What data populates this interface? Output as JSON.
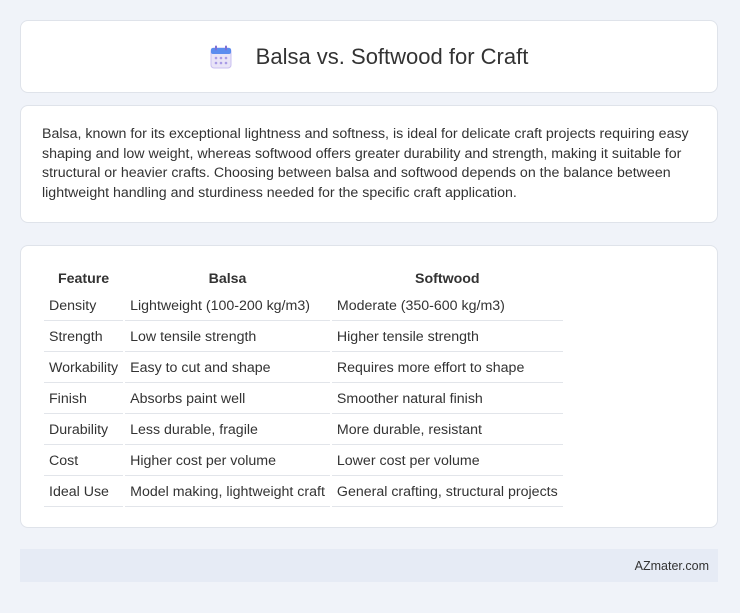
{
  "header": {
    "title": "Balsa vs. Softwood for Craft",
    "icon": "calendar-icon"
  },
  "description": "Balsa, known for its exceptional lightness and softness, is ideal for delicate craft projects requiring easy shaping and low weight, whereas softwood offers greater durability and strength, making it suitable for structural or heavier crafts. Choosing between balsa and softwood depends on the balance between lightweight handling and sturdiness needed for the specific craft application.",
  "table": {
    "headers": [
      "Feature",
      "Balsa",
      "Softwood"
    ],
    "rows": [
      [
        "Density",
        "Lightweight (100-200 kg/m3)",
        "Moderate (350-600 kg/m3)"
      ],
      [
        "Strength",
        "Low tensile strength",
        "Higher tensile strength"
      ],
      [
        "Workability",
        "Easy to cut and shape",
        "Requires more effort to shape"
      ],
      [
        "Finish",
        "Absorbs paint well",
        "Smoother natural finish"
      ],
      [
        "Durability",
        "Less durable, fragile",
        "More durable, resistant"
      ],
      [
        "Cost",
        "Higher cost per volume",
        "Lower cost per volume"
      ],
      [
        "Ideal Use",
        "Model making, lightweight craft",
        "General crafting, structural projects"
      ]
    ]
  },
  "footer": {
    "brand": "AZmater.com"
  }
}
